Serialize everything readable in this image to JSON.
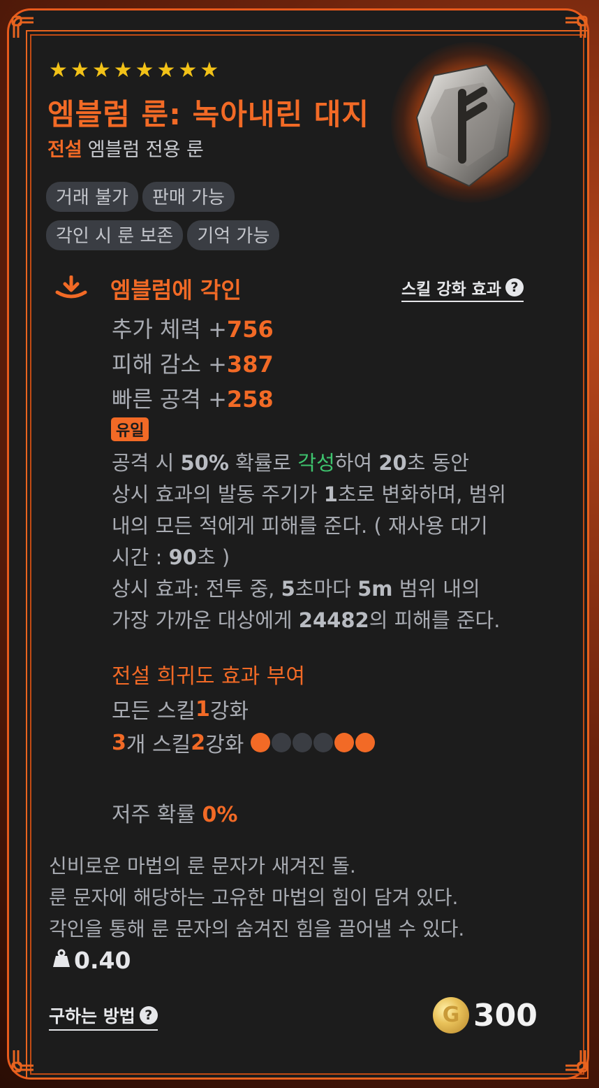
{
  "item": {
    "stars": [
      "★",
      "★",
      "★",
      "★",
      "★",
      "★",
      "★",
      "★"
    ],
    "title": "엠블럼 룬: 녹아내린 대지",
    "grade": "전설",
    "category": "엠블럼 전용 룬",
    "tags": [
      "거래 불가",
      "판매 가능",
      "각인 시 룬 보존",
      "기억 가능"
    ]
  },
  "engrave": {
    "title": "엠블럼에 각인",
    "skill_link": "스킬 강화 효과",
    "help_glyph": "?",
    "stats": [
      {
        "label": "추가 체력 +",
        "value": "756"
      },
      {
        "label": "피해 감소 +",
        "value": "387"
      },
      {
        "label": "빠른 공격 +",
        "value": "258"
      }
    ],
    "unique_badge": "유일",
    "effect": {
      "l1_a": "공격 시 ",
      "l1_b": "50%",
      "l1_c": " 확률로 ",
      "l1_d": "각성",
      "l1_e": "하여 ",
      "l1_f": "20",
      "l1_g": "초 동안",
      "l2_a": "상시 효과의 발동 주기가 ",
      "l2_b": "1",
      "l2_c": "초로 변화하며, 범위",
      "l3": "내의 모든 적에게 피해를 준다. ( 재사용 대기",
      "l4_a": "시간 : ",
      "l4_b": "90",
      "l4_c": "초 )",
      "l5_a": "상시 효과: 전투 중, ",
      "l5_b": "5",
      "l5_c": "초마다 ",
      "l5_d": "5m",
      "l5_e": " 범위 내의",
      "l6_a": "가장 가까운 대상에게 ",
      "l6_b": "24482",
      "l6_c": "의 피해를 준다."
    }
  },
  "legend_bonus": {
    "title": "전설 희귀도 효과 부여",
    "line1_a": "모든 스킬 ",
    "line1_b": "1",
    "line1_c": "강화",
    "line2_a": "3",
    "line2_b": "개 스킬 ",
    "line2_c": "2",
    "line2_d": "강화",
    "dots": [
      "#f26a26",
      "#3a3d43",
      "#3a3d43",
      "#3a3d43",
      "#f26a26",
      "#f26a26"
    ]
  },
  "curse": {
    "label": "저주 확률 ",
    "value": "0%"
  },
  "flavor": [
    "신비로운 마법의 룬 문자가 새겨진 돌.",
    "룬 문자에 해당하는 고유한 마법의 힘이 담겨 있다.",
    "각인을 통해 룬 문자의 숨겨진 힘을 끌어낼 수 있다."
  ],
  "weight": "0.40",
  "how_to_get": "구하는 방법",
  "price": "300",
  "coin_glyph": "G",
  "colors": {
    "accent": "#f26a26",
    "gold_star": "#f2c218",
    "awaken_green": "#3ec46e",
    "card_bg": "#1c1c1c"
  }
}
